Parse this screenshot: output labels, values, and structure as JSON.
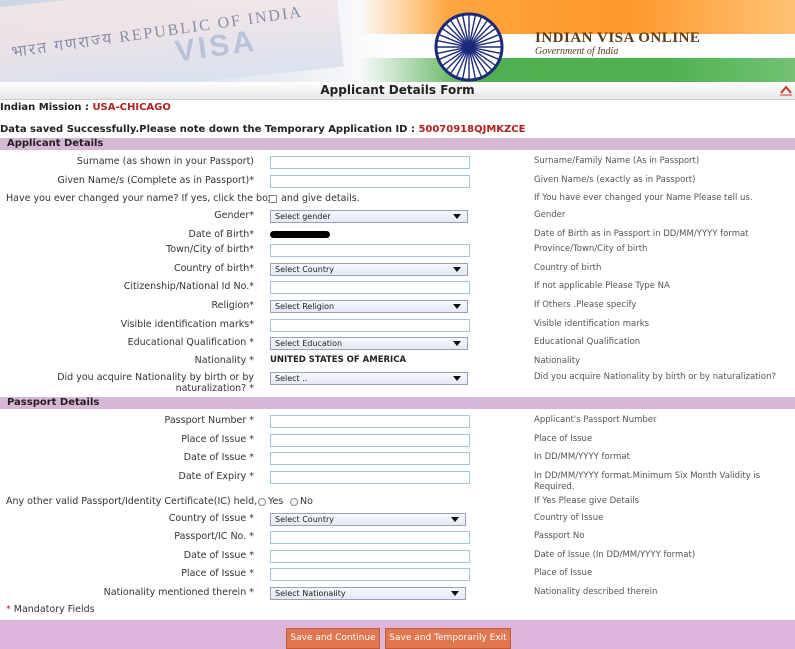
{
  "banner": {
    "passport_text": "भारत गणराज्य REPUBLIC OF INDIA",
    "visa_word": "VISA",
    "brand_title": "INDIAN VISA ONLINE",
    "brand_sub": "Government of India"
  },
  "page_title": "Applicant Details Form",
  "mission": {
    "label": "Indian Mission : ",
    "value": "USA-CHICAGO"
  },
  "saved": {
    "label": "Data saved Successfully.Please note down the Temporary Application ID : ",
    "value": "50070918QJMKZCE"
  },
  "sections": {
    "applicant": "Applicant Details",
    "passport": "Passport Details"
  },
  "applicant": {
    "surname": {
      "label": "Surname (as shown in your Passport)",
      "hint": "Surname/Family Name (As in Passport)"
    },
    "given": {
      "label": "Given Name/s (Complete as in Passport)*",
      "hint": "Given Name/s (exactly as in Passport)"
    },
    "changed": {
      "label": "Have you ever changed your name? If yes, click the box",
      "after": "and give details.",
      "hint": "If You have ever changed your Name Please tell us."
    },
    "gender": {
      "label": "Gender*",
      "value": "Select gender",
      "hint": "Gender"
    },
    "dob": {
      "label": "Date of Birth*",
      "hint": "Date of Birth as in Passport in DD/MM/YYYY format"
    },
    "town": {
      "label": "Town/City of birth*",
      "hint": "Province/Town/City of birth"
    },
    "country": {
      "label": "Country of birth*",
      "value": "Select Country",
      "hint": "Country of birth"
    },
    "citizenship": {
      "label": "Citizenship/National Id No.*",
      "hint": "If not applicable Please Type NA"
    },
    "religion": {
      "label": "Religion*",
      "value": "Select Religion",
      "hint": "If Others .Please specify"
    },
    "marks": {
      "label": "Visible identification marks*",
      "hint": "Visible identification marks"
    },
    "education": {
      "label": "Educational Qualification *",
      "value": "Select Education",
      "hint": "Educational Qualification"
    },
    "nationality": {
      "label": "Nationality *",
      "value": "UNITED STATES OF AMERICA",
      "hint": "Nationality"
    },
    "acquire": {
      "label": "Did you acquire Nationality by birth or by naturalization? *",
      "value": "Select ..",
      "hint": "Did you acquire Nationality by birth or by naturalization?"
    }
  },
  "passport": {
    "number": {
      "label": "Passport Number *",
      "hint": "Applicant's Passport Number"
    },
    "place": {
      "label": "Place of Issue *",
      "hint": "Place of Issue"
    },
    "doi": {
      "label": "Date of Issue *",
      "hint": "In DD/MM/YYYY format"
    },
    "doe": {
      "label": "Date of Expiry *",
      "hint": "In DD/MM/YYYY format.Minimum Six Month Validity is Required."
    },
    "other": {
      "label": "Any other valid Passport/Identity Certificate(IC) held,",
      "yes": "Yes",
      "no": "No",
      "hint": "If Yes Please give Details"
    },
    "ic_country": {
      "label": "Country of Issue *",
      "value": "Select Country",
      "hint": "Country of Issue"
    },
    "ic_no": {
      "label": "Passport/IC No. *",
      "hint": "Passport No"
    },
    "ic_doi": {
      "label": "Date of Issue *",
      "hint": "Date of Issue (In DD/MM/YYYY format)"
    },
    "ic_place": {
      "label": "Place of Issue *",
      "hint": "Place of Issue"
    },
    "ic_nat": {
      "label": "Nationality mentioned therein *",
      "value": "Select Nationality",
      "hint": "Nationality described therein"
    }
  },
  "mandatory": {
    "star": "*",
    "text": " Mandatory Fields"
  },
  "buttons": {
    "save_continue": "Save and Continue",
    "save_exit": "Save and Temporarily Exit"
  }
}
